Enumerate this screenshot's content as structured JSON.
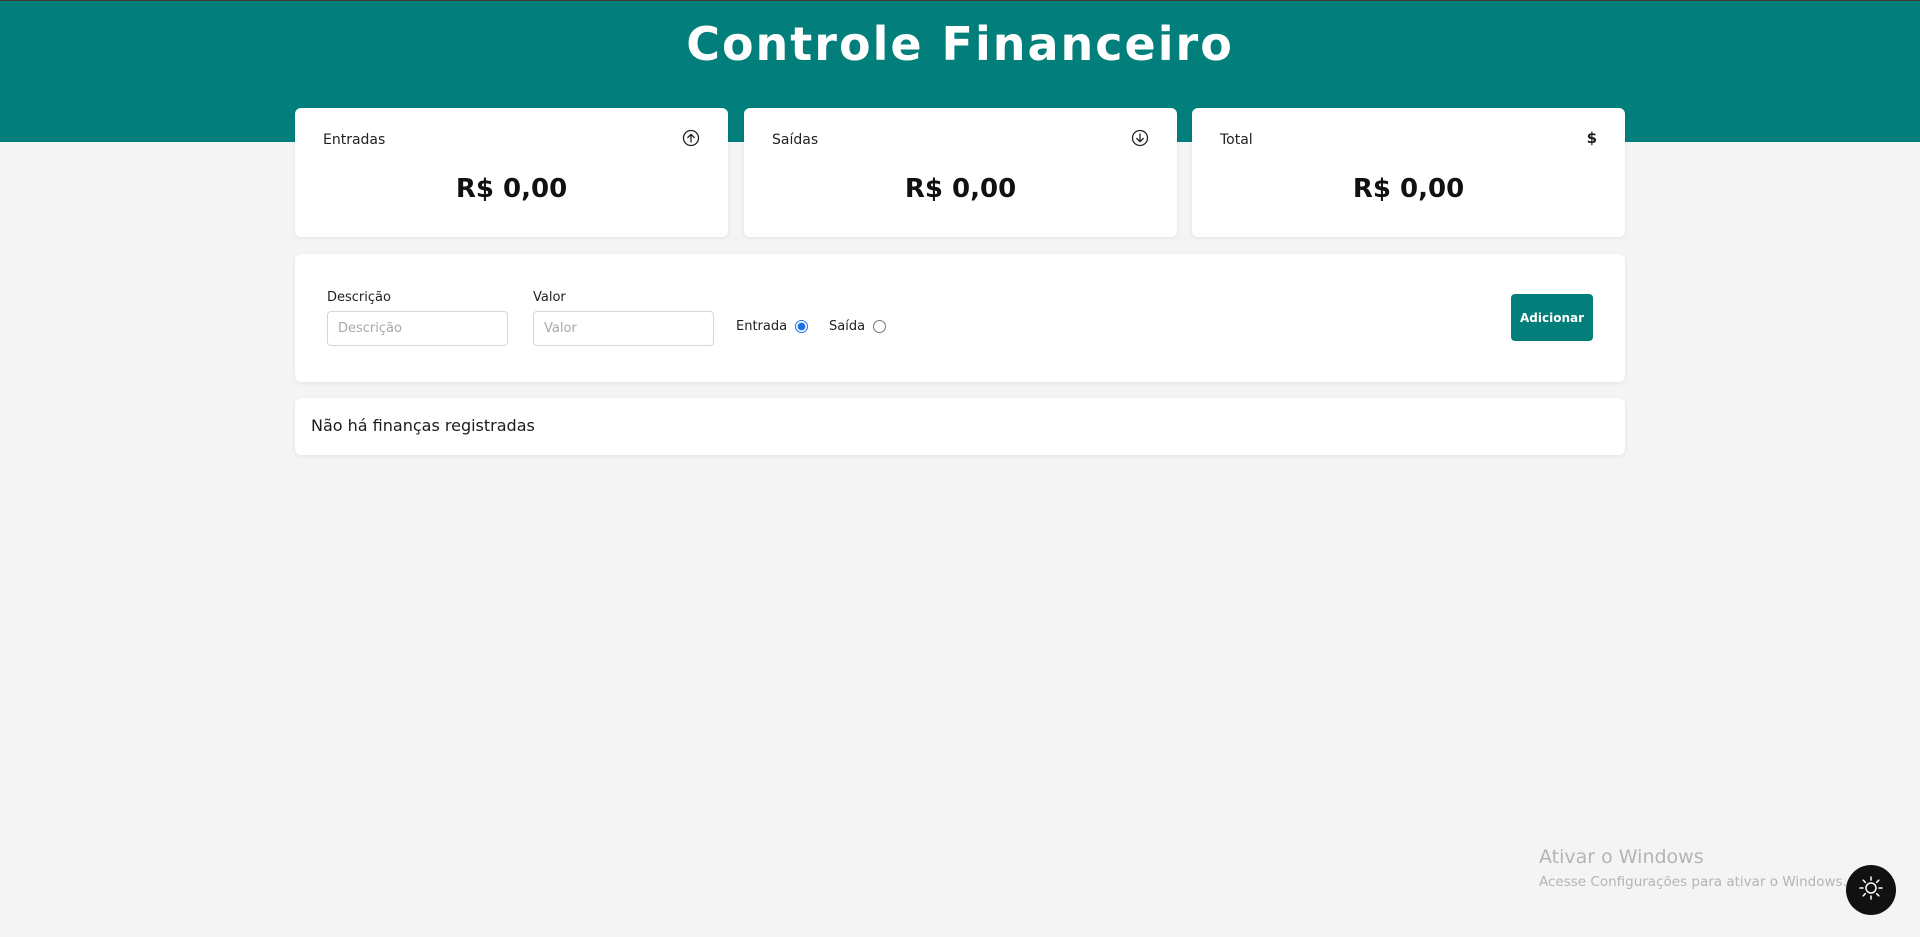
{
  "header": {
    "title": "Controle Financeiro"
  },
  "summary": [
    {
      "label": "Entradas",
      "icon": "arrow-up-circle-icon",
      "value": "R$ 0,00"
    },
    {
      "label": "Saídas",
      "icon": "arrow-down-circle-icon",
      "value": "R$ 0,00"
    },
    {
      "label": "Total",
      "icon": "dollar-icon",
      "icon_glyph": "$",
      "value": "R$ 0,00"
    }
  ],
  "form": {
    "description_label": "Descrição",
    "description_placeholder": "Descrição",
    "value_label": "Valor",
    "value_placeholder": "Valor",
    "type_options": [
      {
        "label": "Entrada",
        "checked": true
      },
      {
        "label": "Saída",
        "checked": false
      }
    ],
    "add_button": "Adicionar"
  },
  "list": {
    "empty_message": "Não há finanças registradas"
  },
  "watermark": {
    "title": "Ativar o Windows",
    "subtitle": "Acesse Configurações para ativar o Windows."
  },
  "theme_toggle": {
    "icon": "sun-icon"
  },
  "colors": {
    "accent": "#027f7b",
    "background": "#f4f4f4",
    "card": "#ffffff",
    "toggle": "#111111"
  }
}
